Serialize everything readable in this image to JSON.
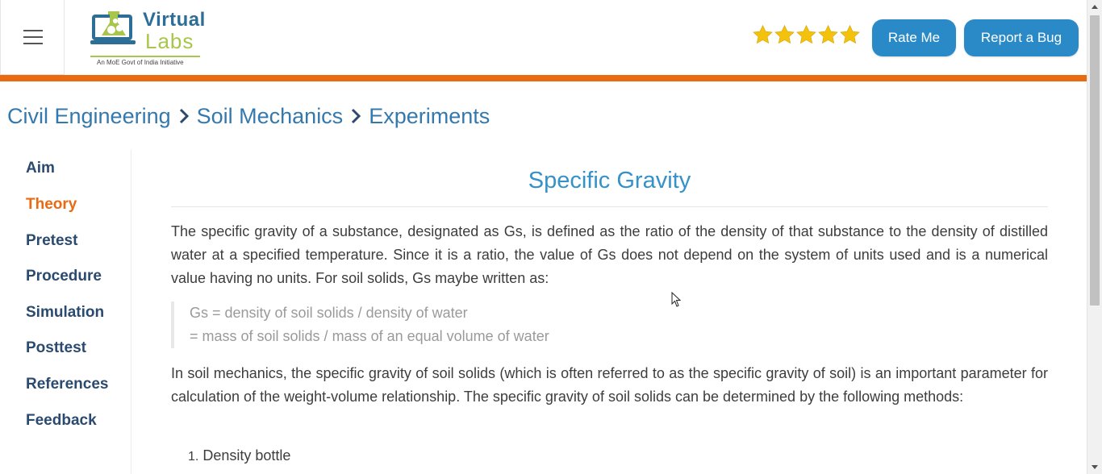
{
  "header": {
    "logo": {
      "word1": "Virtual",
      "word2": "Labs",
      "tagline": "An MoE Govt of India Initiative"
    },
    "rating": {
      "stars": 5,
      "max": 5
    },
    "buttons": {
      "rate_me": "Rate Me",
      "report_bug": "Report a Bug"
    }
  },
  "breadcrumb": [
    "Civil Engineering",
    "Soil Mechanics",
    "Experiments"
  ],
  "sidebar": {
    "items": [
      {
        "label": "Aim",
        "active": false
      },
      {
        "label": "Theory",
        "active": true
      },
      {
        "label": "Pretest",
        "active": false
      },
      {
        "label": "Procedure",
        "active": false
      },
      {
        "label": "Simulation",
        "active": false
      },
      {
        "label": "Posttest",
        "active": false
      },
      {
        "label": "References",
        "active": false
      },
      {
        "label": "Feedback",
        "active": false
      }
    ]
  },
  "main": {
    "title": "Specific Gravity",
    "paragraph1": "The specific gravity of a substance, designated as Gs, is defined as the ratio of the density of that substance to the density of distilled water at a specified temperature. Since it is a ratio, the value of Gs does not depend on the system of units used and is a numerical value having no units. For soil solids, Gs maybe written as:",
    "formula": [
      "Gs = density of soil solids / density of water",
      "= mass of soil solids / mass of an equal volume of water"
    ],
    "paragraph2": "In soil mechanics, the specific gravity of soil solids (which is often referred to as the specific gravity of soil) is an important parameter for calculation of the weight-volume relationship. The specific gravity of soil solids can be determined by the following methods:",
    "methods": [
      {
        "number": "1.",
        "text": "Density bottle"
      }
    ]
  },
  "colors": {
    "accent": "#ea6a12",
    "button": "#2a8ac7",
    "title": "#3592c9",
    "breadcrumb": "#3479ad",
    "sidebar_text": "#2b4a6f",
    "star": "#f4c20d"
  },
  "icons": {
    "menu": "hamburger-icon",
    "breadcrumb_separator": "chevron-right-icon",
    "rating": "star-icon"
  }
}
